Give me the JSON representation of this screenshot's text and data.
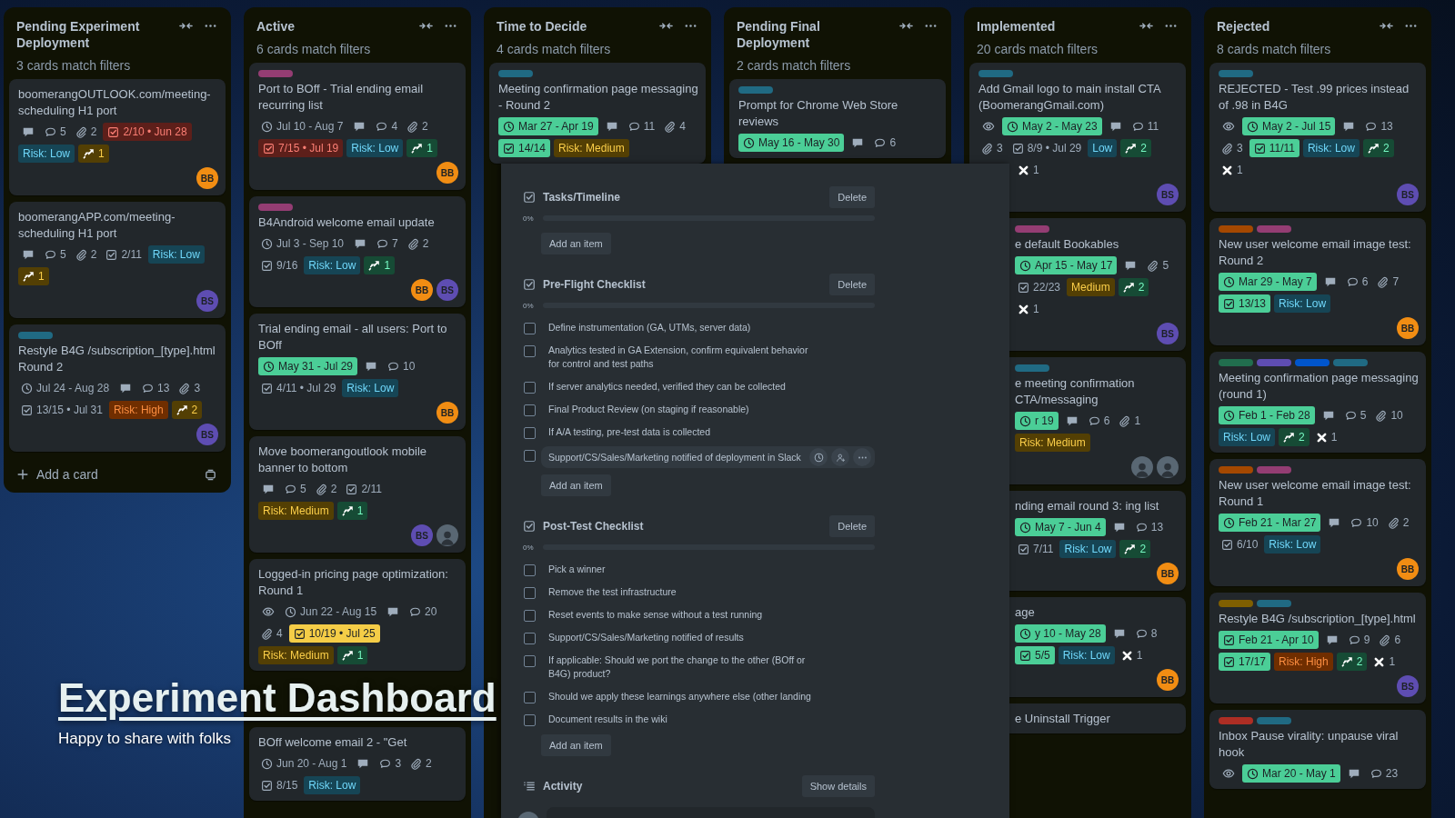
{
  "board": {
    "lists": [
      {
        "title": "Pending Experiment Deployment",
        "count": "3 cards match filters",
        "add_card": "Add a card",
        "cards": [
          {
            "title": "boomerangOUTLOOK.com/meeting-scheduling H1 port",
            "badges": [
              {
                "kind": "description"
              },
              {
                "kind": "comments",
                "text": "5"
              },
              {
                "kind": "attachments",
                "text": "2"
              },
              {
                "kind": "checklist",
                "text": "2/10 • Jun 28",
                "color": "#5d1f1a"
              },
              {
                "kind": "risk",
                "text": "Risk: Low",
                "color": "#164555"
              },
              {
                "kind": "issues",
                "text": "1",
                "color": "#533f04"
              }
            ],
            "members": [
              {
                "kind": "initials",
                "initials": "BB",
                "color": "#f18d13"
              }
            ]
          },
          {
            "title": "boomerangAPP.com/meeting-scheduling H1 port",
            "badges": [
              {
                "kind": "description"
              },
              {
                "kind": "comments",
                "text": "5"
              },
              {
                "kind": "attachments",
                "text": "2"
              },
              {
                "kind": "checklist",
                "text": "2/11",
                "complete": false
              },
              {
                "kind": "risk",
                "text": "Risk: Low",
                "color": "#164555"
              },
              {
                "kind": "issues",
                "text": "1",
                "color": "#533f04"
              }
            ],
            "members": [
              {
                "kind": "initials",
                "initials": "BS",
                "color": "#5e4db2"
              }
            ]
          },
          {
            "labels": [
              {
                "color": "#206a83"
              }
            ],
            "title": "Restyle B4G /subscription_[type].html Round 2",
            "badges": [
              {
                "kind": "dates",
                "text": "Jul 24 - Aug 28"
              },
              {
                "kind": "description"
              },
              {
                "kind": "comments",
                "text": "13"
              },
              {
                "kind": "attachments",
                "text": "3"
              },
              {
                "kind": "checklist",
                "text": "13/15 • Jul 31",
                "complete": false
              },
              {
                "kind": "risk",
                "text": "Risk: High",
                "color": "#702e00"
              },
              {
                "kind": "issues",
                "text": "2",
                "color": "#533f04"
              }
            ],
            "members": [
              {
                "kind": "initials",
                "initials": "BS",
                "color": "#5e4db2"
              }
            ]
          }
        ]
      },
      {
        "title": "Active",
        "count": "6 cards match filters",
        "cards": [
          {
            "labels": [
              {
                "color": "#943d73"
              }
            ],
            "title": "Port to BOff - Trial ending email recurring list",
            "badges": [
              {
                "kind": "dates",
                "text": "Jul 10 - Aug 7"
              },
              {
                "kind": "description"
              },
              {
                "kind": "comments",
                "text": "4"
              },
              {
                "kind": "attachments",
                "text": "2"
              },
              {
                "kind": "checklist",
                "text": "7/15 • Jul 19",
                "color": "#5d1f1a"
              },
              {
                "kind": "risk",
                "text": "Risk: Low",
                "color": "#164555"
              },
              {
                "kind": "issues",
                "text": "1",
                "color": "#164b35"
              }
            ],
            "members": [
              {
                "kind": "initials",
                "initials": "BB",
                "color": "#f18d13"
              }
            ]
          },
          {
            "labels": [
              {
                "color": "#943d73"
              }
            ],
            "title": "B4Android welcome email update",
            "badges": [
              {
                "kind": "dates",
                "text": "Jul 3 - Sep 10"
              },
              {
                "kind": "description"
              },
              {
                "kind": "comments",
                "text": "7"
              },
              {
                "kind": "attachments",
                "text": "2"
              },
              {
                "kind": "checklist",
                "text": "9/16",
                "complete": false
              },
              {
                "kind": "risk",
                "text": "Risk: Low",
                "color": "#164555"
              },
              {
                "kind": "issues",
                "text": "1",
                "color": "#164b35"
              }
            ],
            "members": [
              {
                "kind": "initials",
                "initials": "BB",
                "color": "#f18d13"
              },
              {
                "kind": "initials",
                "initials": "BS",
                "color": "#5e4db2"
              }
            ]
          },
          {
            "title": "Trial ending email - all users: Port to BOff",
            "badges": [
              {
                "kind": "dates",
                "text": "May 31 - Jul 29",
                "color": "#4bce97"
              },
              {
                "kind": "description"
              },
              {
                "kind": "comments",
                "text": "10"
              },
              {
                "kind": "checklist",
                "text": "4/11 • Jul 29",
                "complete": false
              },
              {
                "kind": "risk",
                "text": "Risk: Low",
                "color": "#164555"
              }
            ],
            "members": [
              {
                "kind": "initials",
                "initials": "BB",
                "color": "#f18d13"
              }
            ]
          },
          {
            "title": "Move boomerangoutlook mobile banner to bottom",
            "badges": [
              {
                "kind": "description"
              },
              {
                "kind": "comments",
                "text": "5"
              },
              {
                "kind": "attachments",
                "text": "2"
              },
              {
                "kind": "checklist",
                "text": "2/11",
                "complete": false
              },
              {
                "kind": "risk",
                "text": "Risk: Medium",
                "color": "#533f04"
              },
              {
                "kind": "issues",
                "text": "1",
                "color": "#164b35"
              }
            ],
            "members": [
              {
                "kind": "initials",
                "initials": "BS",
                "color": "#5e4db2"
              },
              {
                "kind": "photo"
              }
            ]
          },
          {
            "title": "Logged-in pricing page optimization: Round 1",
            "badges": [
              {
                "kind": "watch"
              },
              {
                "kind": "dates",
                "text": "Jun 22 - Aug 15"
              },
              {
                "kind": "description"
              },
              {
                "kind": "comments",
                "text": "20"
              },
              {
                "kind": "attachments",
                "text": "4"
              },
              {
                "kind": "checklist",
                "text": "10/19 • Jul 25",
                "color": "#f5cd47"
              },
              {
                "kind": "risk",
                "text": "Risk: Medium",
                "color": "#533f04"
              },
              {
                "kind": "issues",
                "text": "1",
                "color": "#164b35"
              }
            ]
          },
          {
            "title": "BOff welcome email 2 - \"Get",
            "badges": [
              {
                "kind": "dates",
                "text": "Jun 20 - Aug 1"
              },
              {
                "kind": "description"
              },
              {
                "kind": "comments",
                "text": "3"
              },
              {
                "kind": "attachments",
                "text": "2"
              },
              {
                "kind": "checklist",
                "text": "8/15",
                "complete": false
              },
              {
                "kind": "risk",
                "text": "Risk: Low",
                "color": "#164555"
              }
            ]
          }
        ]
      },
      {
        "title": "Time to Decide",
        "count": "4 cards match filters",
        "cards": [
          {
            "labels": [
              {
                "color": "#206a83"
              }
            ],
            "title": "Meeting confirmation page messaging - Round 2",
            "badges": [
              {
                "kind": "dates",
                "text": "Mar 27 - Apr 19",
                "color": "#4bce97"
              },
              {
                "kind": "description"
              },
              {
                "kind": "comments",
                "text": "11"
              },
              {
                "kind": "attachments",
                "text": "4"
              },
              {
                "kind": "checklist",
                "text": "14/14",
                "color": "#4bce97"
              },
              {
                "kind": "risk",
                "text": "Risk: Medium",
                "color": "#533f04"
              }
            ]
          }
        ]
      },
      {
        "title": "Pending Final Deployment",
        "count": "2 cards match filters",
        "cards": [
          {
            "labels": [
              {
                "color": "#206a83"
              }
            ],
            "title": "Prompt for Chrome Web Store reviews",
            "badges": [
              {
                "kind": "dates",
                "text": "May 16 - May 30",
                "color": "#4bce97"
              },
              {
                "kind": "description"
              },
              {
                "kind": "comments",
                "text": "6"
              }
            ]
          }
        ]
      },
      {
        "title": "Implemented",
        "count": "20 cards match filters",
        "cards": [
          {
            "labels": [
              {
                "color": "#206a83"
              }
            ],
            "title": "Add Gmail logo to main install CTA (BoomerangGmail.com)",
            "badges": [
              {
                "kind": "watch"
              },
              {
                "kind": "dates",
                "text": "May 2 - May 23",
                "color": "#4bce97"
              },
              {
                "kind": "description"
              },
              {
                "kind": "comments",
                "text": "11"
              },
              {
                "kind": "attachments",
                "text": "3"
              },
              {
                "kind": "checklist",
                "text": "8/9 • Jul 29",
                "complete": false
              },
              {
                "kind": "risk",
                "text": "Low",
                "color": "#164555"
              },
              {
                "kind": "issues",
                "text": "2",
                "color": "#164b35"
              },
              {
                "kind": "crossed",
                "text": "1"
              }
            ],
            "members": [
              {
                "kind": "initials",
                "initials": "BS",
                "color": "#5e4db2"
              }
            ]
          },
          {
            "labels": [
              {
                "color": "#943d73"
              }
            ],
            "title": "e default Bookables",
            "badges": [
              {
                "kind": "dates",
                "text": "Apr 15 - May 17",
                "color": "#4bce97"
              },
              {
                "kind": "description"
              },
              {
                "kind": "attachments",
                "text": "5"
              },
              {
                "kind": "checklist",
                "text": "22/23",
                "complete": false
              },
              {
                "kind": "risk",
                "text": "Medium",
                "color": "#533f04"
              },
              {
                "kind": "issues",
                "text": "2",
                "color": "#164b35"
              },
              {
                "kind": "crossed",
                "text": "1"
              }
            ],
            "members": [
              {
                "kind": "initials",
                "initials": "BS",
                "color": "#5e4db2"
              }
            ]
          },
          {
            "labels": [
              {
                "color": "#206a83"
              }
            ],
            "title": "e meeting confirmation CTA/messaging",
            "badges": [
              {
                "kind": "dates",
                "text": "r 19",
                "color": "#4bce97"
              },
              {
                "kind": "description"
              },
              {
                "kind": "comments",
                "text": "6"
              },
              {
                "kind": "attachments",
                "text": "1"
              },
              {
                "kind": "risk",
                "text": "Risk: Medium",
                "color": "#533f04"
              }
            ],
            "members": [
              {
                "kind": "photo"
              },
              {
                "kind": "photo"
              }
            ]
          },
          {
            "title": "nding email round 3: ing list",
            "badges": [
              {
                "kind": "dates",
                "text": "May 7 - Jun 4",
                "color": "#4bce97"
              },
              {
                "kind": "description"
              },
              {
                "kind": "comments",
                "text": "13"
              },
              {
                "kind": "checklist",
                "text": "7/11",
                "complete": false
              },
              {
                "kind": "risk",
                "text": "Risk: Low",
                "color": "#164555"
              },
              {
                "kind": "issues",
                "text": "2",
                "color": "#164b35"
              }
            ],
            "members": [
              {
                "kind": "initials",
                "initials": "BB",
                "color": "#f18d13"
              }
            ]
          },
          {
            "title": "age",
            "badges": [
              {
                "kind": "dates",
                "text": "y 10 - May 28",
                "color": "#4bce97"
              },
              {
                "kind": "description"
              },
              {
                "kind": "comments",
                "text": "8"
              },
              {
                "kind": "checklist",
                "text": "5/5",
                "color": "#4bce97"
              },
              {
                "kind": "risk",
                "text": "Risk: Low",
                "color": "#164555"
              },
              {
                "kind": "crossed",
                "text": "1"
              }
            ],
            "members": [
              {
                "kind": "initials",
                "initials": "BB",
                "color": "#f18d13"
              }
            ]
          },
          {
            "title": "e Uninstall Trigger"
          }
        ]
      },
      {
        "title": "Rejected",
        "count": "8 cards match filters",
        "cards": [
          {
            "labels": [
              {
                "color": "#206a83"
              }
            ],
            "title": "REJECTED - Test .99 prices instead of .98 in B4G",
            "badges": [
              {
                "kind": "watch"
              },
              {
                "kind": "dates",
                "text": "May 2 - Jul 15",
                "color": "#4bce97"
              },
              {
                "kind": "description"
              },
              {
                "kind": "comments",
                "text": "13"
              },
              {
                "kind": "attachments",
                "text": "3"
              },
              {
                "kind": "checklist",
                "text": "11/11",
                "color": "#4bce97"
              },
              {
                "kind": "risk",
                "text": "Risk: Low",
                "color": "#164555"
              },
              {
                "kind": "issues",
                "text": "2",
                "color": "#164b35"
              },
              {
                "kind": "crossed",
                "text": "1"
              }
            ],
            "members": [
              {
                "kind": "initials",
                "initials": "BS",
                "color": "#5e4db2"
              }
            ]
          },
          {
            "labels": [
              {
                "color": "#a54800"
              },
              {
                "color": "#943d73"
              }
            ],
            "title": "New user welcome email image test: Round 2",
            "badges": [
              {
                "kind": "dates",
                "text": "Mar 29 - May 7",
                "color": "#4bce97"
              },
              {
                "kind": "description"
              },
              {
                "kind": "comments",
                "text": "6"
              },
              {
                "kind": "attachments",
                "text": "7"
              },
              {
                "kind": "checklist",
                "text": "13/13",
                "color": "#4bce97"
              },
              {
                "kind": "risk",
                "text": "Risk: Low",
                "color": "#164555"
              }
            ],
            "members": [
              {
                "kind": "initials",
                "initials": "BB",
                "color": "#f18d13"
              }
            ]
          },
          {
            "labels": [
              {
                "color": "#216e4e"
              },
              {
                "color": "#5e4db2"
              },
              {
                "color": "#0055cc"
              },
              {
                "color": "#206a83"
              }
            ],
            "title": "Meeting confirmation page messaging (round 1)",
            "badges": [
              {
                "kind": "dates",
                "text": "Feb 1 - Feb 28",
                "color": "#4bce97"
              },
              {
                "kind": "description"
              },
              {
                "kind": "comments",
                "text": "5"
              },
              {
                "kind": "attachments",
                "text": "10"
              },
              {
                "kind": "risk",
                "text": "Risk: Low",
                "color": "#164555"
              },
              {
                "kind": "issues",
                "text": "2",
                "color": "#164b35"
              },
              {
                "kind": "crossed",
                "text": "1"
              }
            ]
          },
          {
            "labels": [
              {
                "color": "#a54800"
              },
              {
                "color": "#943d73"
              }
            ],
            "title": "New user welcome email image test: Round 1",
            "badges": [
              {
                "kind": "dates",
                "text": "Feb 21 - Mar 27",
                "color": "#4bce97"
              },
              {
                "kind": "description"
              },
              {
                "kind": "comments",
                "text": "10"
              },
              {
                "kind": "attachments",
                "text": "2"
              },
              {
                "kind": "checklist",
                "text": "6/10",
                "complete": false
              },
              {
                "kind": "risk",
                "text": "Risk: Low",
                "color": "#164555"
              }
            ],
            "members": [
              {
                "kind": "initials",
                "initials": "BB",
                "color": "#f18d13"
              }
            ]
          },
          {
            "labels": [
              {
                "color": "#7f5f01"
              },
              {
                "color": "#206a83"
              }
            ],
            "title": "Restyle B4G /subscription_[type].html",
            "badges": [
              {
                "kind": "checkdates",
                "text": "Feb 21 - Apr 10",
                "color": "#4bce97"
              },
              {
                "kind": "description"
              },
              {
                "kind": "comments",
                "text": "9"
              },
              {
                "kind": "attachments",
                "text": "6"
              },
              {
                "kind": "checklist",
                "text": "17/17",
                "color": "#4bce97"
              },
              {
                "kind": "risk",
                "text": "Risk: High",
                "color": "#702e00"
              },
              {
                "kind": "issues",
                "text": "2",
                "color": "#164b35"
              },
              {
                "kind": "crossed",
                "text": "1"
              }
            ],
            "members": [
              {
                "kind": "initials",
                "initials": "BS",
                "color": "#5e4db2"
              }
            ]
          },
          {
            "labels": [
              {
                "color": "#ae2e24"
              },
              {
                "color": "#206a83"
              }
            ],
            "title": "Inbox Pause virality: unpause viral hook",
            "badges": [
              {
                "kind": "watch"
              },
              {
                "kind": "dates",
                "text": "Mar 20 - May 1",
                "color": "#4bce97"
              },
              {
                "kind": "description"
              },
              {
                "kind": "comments",
                "text": "23"
              }
            ]
          }
        ]
      }
    ]
  },
  "card_detail": {
    "checklists": [
      {
        "title": "Tasks/Timeline",
        "delete": "Delete",
        "percent": "0%",
        "level": 0,
        "add_item": "Add an item"
      },
      {
        "title": "Pre-Flight Checklist",
        "delete": "Delete",
        "percent": "0%",
        "level": 0,
        "add_item": "Add an item",
        "items": [
          {
            "text": "Define instrumentation (GA, UTMs, server data)",
            "checked": false,
            "hovered": false
          },
          {
            "text": "Analytics tested in GA Extension, confirm equivalent behavior for control and test paths",
            "checked": false,
            "hovered": false
          },
          {
            "text": "If server analytics needed, verified they can be collected",
            "checked": false,
            "hovered": false
          },
          {
            "text": "Final Product Review (on staging if reasonable)",
            "checked": false,
            "hovered": false
          },
          {
            "text": "If A/A testing, pre-test data is collected",
            "checked": false,
            "hovered": false
          },
          {
            "text": "Support/CS/Sales/Marketing notified of deployment in Slack",
            "checked": false,
            "hovered": true
          }
        ]
      },
      {
        "title": "Post-Test Checklist",
        "delete": "Delete",
        "percent": "0%",
        "level": 0,
        "add_item": "Add an item",
        "items": [
          {
            "text": "Pick a winner",
            "checked": false,
            "hovered": false
          },
          {
            "text": "Remove the test infrastructure",
            "checked": false,
            "hovered": false
          },
          {
            "text": "Reset events to make sense without a test running",
            "checked": false,
            "hovered": false
          },
          {
            "text": "Support/CS/Sales/Marketing notified of results",
            "checked": false,
            "hovered": false
          },
          {
            "text": "If applicable: Should we port the change to the other (BOff or B4G) product?",
            "checked": false,
            "hovered": false
          },
          {
            "text": "Should we apply these learnings anywhere else (other landing",
            "checked": false,
            "hovered": false
          },
          {
            "text": "Document results in the wiki",
            "checked": false,
            "hovered": false
          }
        ]
      }
    ],
    "activity": {
      "title": "Activity",
      "button": "Show details"
    }
  },
  "overlay": {
    "title": "Experiment Dashboard",
    "subtitle": "Happy to share with folks"
  }
}
